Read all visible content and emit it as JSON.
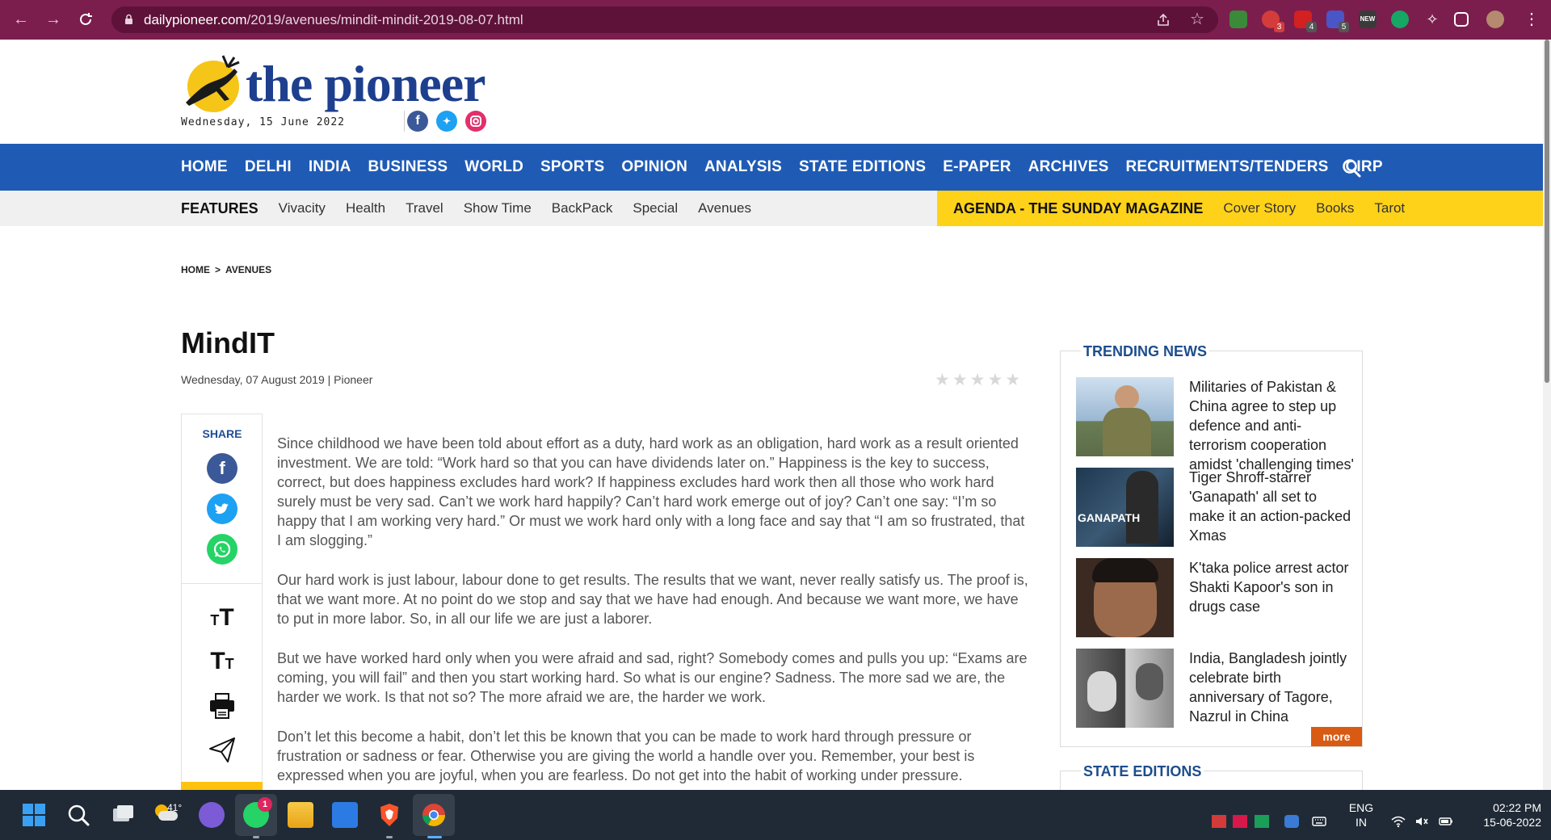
{
  "browser": {
    "url_host": "dailypioneer.com",
    "url_path": "/2019/avenues/mindit-mindit-2019-08-07.html",
    "ext_badges": [
      "3",
      "4",
      "5"
    ],
    "ext_new_label": "NEW"
  },
  "site": {
    "logo_text": "the pioneer",
    "date": "Wednesday, 15 June 2022"
  },
  "main_nav": [
    "HOME",
    "DELHI",
    "INDIA",
    "BUSINESS",
    "WORLD",
    "SPORTS",
    "OPINION",
    "ANALYSIS",
    "STATE EDITIONS",
    "E-PAPER",
    "ARCHIVES",
    "RECRUITMENTS/TENDERS",
    "CIRP"
  ],
  "sub_nav": {
    "lead": "FEATURES",
    "items": [
      "Vivacity",
      "Health",
      "Travel",
      "Show Time",
      "BackPack",
      "Special",
      "Avenues"
    ]
  },
  "agenda_nav": {
    "lead": "AGENDA - THE SUNDAY MAGAZINE",
    "items": [
      "Cover Story",
      "Books",
      "Tarot"
    ]
  },
  "breadcrumb": {
    "home": "HOME",
    "separator": ">",
    "current": "AVENUES"
  },
  "article": {
    "title": "MindIT",
    "byline": "Wednesday, 07 August 2019 | Pioneer",
    "rating_stars": 5,
    "rating_value": 0,
    "share_label": "SHARE",
    "paragraphs": [
      "Since childhood we have been told about effort as a duty, hard work as an obligation, hard work as a result oriented investment.  We are told: “Work hard so that you can have dividends later on.” Happiness is the key to success, correct, but does happiness excludes hard work? If happiness excludes hard work then all those who work hard surely must be very sad. Can’t we work hard happily? Can’t hard work emerge out of joy? Can’t one say: “I’m so happy that I am working very hard.” Or must we work hard only with a long face and say that “I am so frustrated, that I am slogging.”",
      "Our hard work is just labour, labour done to get results. The results that we want, never really satisfy us. The proof is, that we want more. At no point do we stop and say that we have had enough. And because we want more, we have to put in more labor. So, in all our life we are just a laborer.",
      "But we have worked hard only when you were afraid and sad, right? Somebody comes and pulls you up: “Exams are coming, you will fail” and then you start working hard. So what is our engine? Sadness. The more sad we are, the harder we work. Is that not so? The more afraid we are, the harder we work.",
      "Don’t let this become a habit, don’t let this be known that you can be made to work hard through pressure or frustration or sadness or fear. Otherwise you are giving the world a handle over you. Remember, your best is expressed when you are joyful, when you are fearless. Do not get into the habit of working under pressure."
    ]
  },
  "trending": {
    "title": "TRENDING NEWS",
    "items": [
      "Militaries of Pakistan & China agree to step up defence and anti-terrorism cooperation amidst 'challenging times'",
      "Tiger Shroff-starrer 'Ganapath' all set to make it an action-packed Xmas",
      "K'taka police arrest actor Shakti Kapoor's son in drugs case",
      "India, Bangladesh jointly celebrate birth anniversary of Tagore, Nazrul in China"
    ],
    "thumb_ganapath_text": "GANAPATH",
    "more_label": "more"
  },
  "state_editions": {
    "title": "STATE EDITIONS"
  },
  "taskbar": {
    "weather_temp": "41°",
    "whatsapp_badge": "1",
    "lang": "ENG",
    "region": "IN",
    "time": "02:22 PM",
    "date": "15-06-2022"
  },
  "colors": {
    "chrome": "#7b1e4e",
    "nav_blue": "#1f5bb5",
    "agenda_yellow": "#ffd21a",
    "heading_blue": "#1d4d8c",
    "more_orange": "#d85a13"
  }
}
